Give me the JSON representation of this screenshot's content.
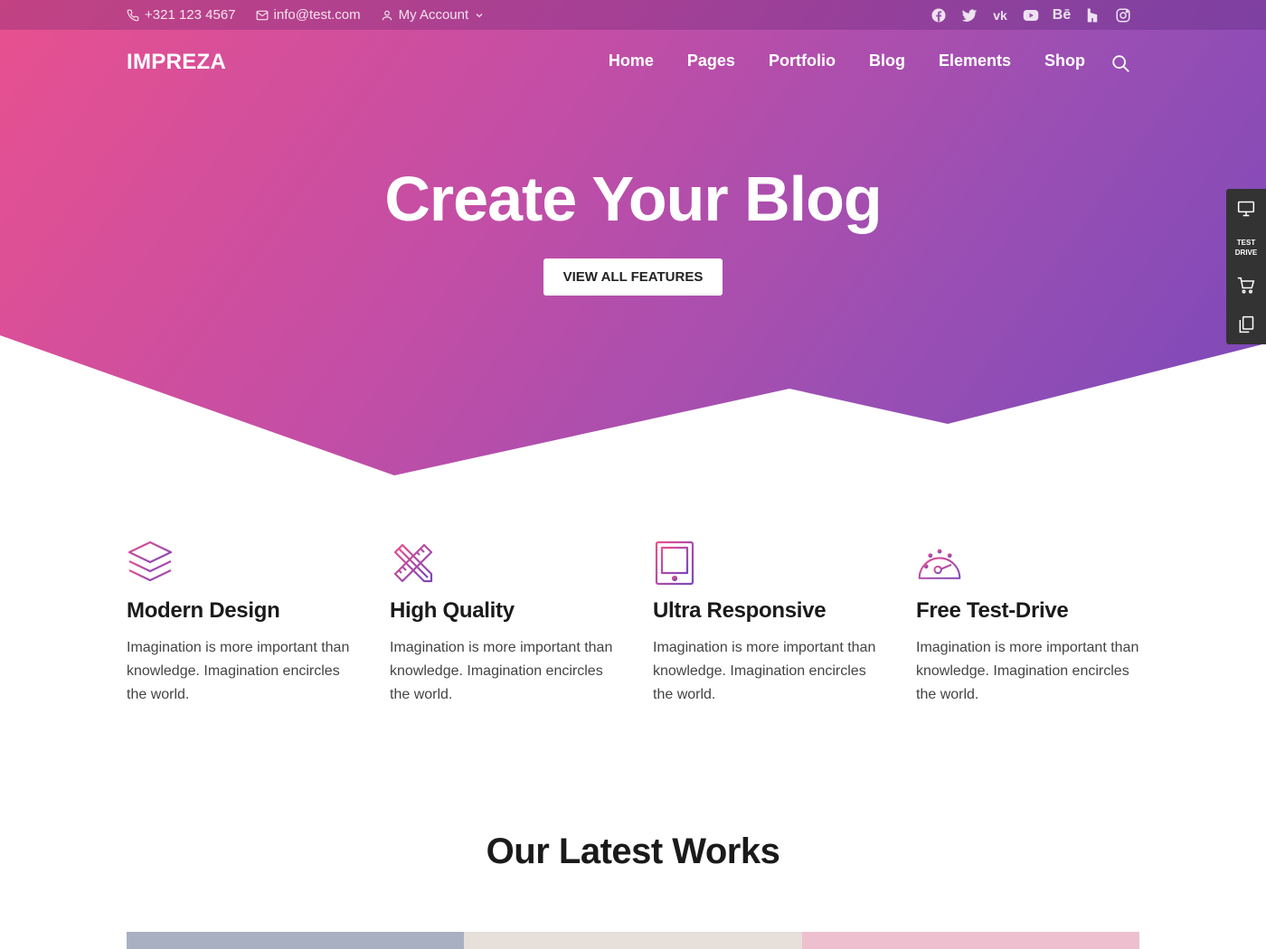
{
  "topbar": {
    "phone": "+321 123 4567",
    "email": "info@test.com",
    "account": "My Account",
    "social": [
      "facebook-icon",
      "twitter-icon",
      "vk-icon",
      "youtube-icon",
      "behance-icon",
      "houzz-icon",
      "instagram-icon"
    ],
    "behance_text": "Bē",
    "vk_text": "vk"
  },
  "header": {
    "logo": "IMPREZA",
    "nav": [
      "Home",
      "Pages",
      "Portfolio",
      "Blog",
      "Elements",
      "Shop"
    ]
  },
  "hero": {
    "title": "Create Your Blog",
    "button": "VIEW ALL FEATURES"
  },
  "sidepanel": {
    "test_drive_label": "TEST DRIVE"
  },
  "features": [
    {
      "title": "Modern Design",
      "text": "Imagination is more important than knowledge. Imagination encircles the world.",
      "icon": "layers-icon"
    },
    {
      "title": "High Quality",
      "text": "Imagination is more important than knowledge. Imagination encircles the world.",
      "icon": "pencil-ruler-icon"
    },
    {
      "title": "Ultra Responsive",
      "text": "Imagination is more important than knowledge. Imagination encircles the world.",
      "icon": "tablet-icon"
    },
    {
      "title": "Free Test-Drive",
      "text": "Imagination is more important than knowledge. Imagination encircles the world.",
      "icon": "speedometer-icon"
    }
  ],
  "works": {
    "title": "Our Latest Works",
    "tile_colors": [
      "#a9b0c2",
      "#e6dfda",
      "#eec0cf"
    ]
  },
  "colors": {
    "gradient_start": "#e8508f",
    "gradient_end": "#7a48ba",
    "sidepanel": "#333333"
  }
}
